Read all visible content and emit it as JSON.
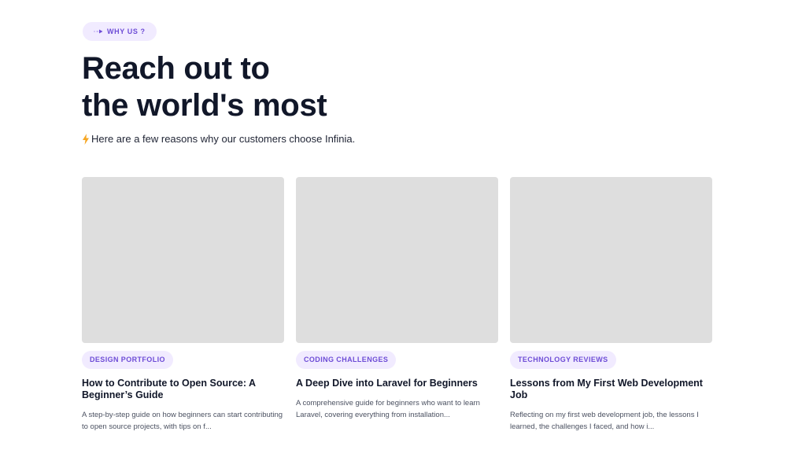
{
  "badge": {
    "label": "WHY US ?",
    "icon": "arrow-right-icon"
  },
  "hero": {
    "title_line1": "Reach out to",
    "title_line2": "the world's most",
    "subtitle": "Here are a few reasons why our customers choose Infinia.",
    "subtitle_icon": "lightning-bolt-icon"
  },
  "colors": {
    "accent": "#6d4cd6",
    "pill_background": "#f1ebff",
    "heading": "#111729",
    "thumbnail_placeholder": "#dedede",
    "bolt": "#f6a623"
  },
  "cards": [
    {
      "tag": "DESIGN PORTFOLIO",
      "title": "How to Contribute to Open Source: A Beginner’s Guide",
      "description": "A step-by-step guide on how beginners can start contributing to open source projects, with tips on f..."
    },
    {
      "tag": "CODING CHALLENGES",
      "title": "A Deep Dive into Laravel for Beginners",
      "description": "A comprehensive guide for beginners who want to learn Laravel, covering everything from installation..."
    },
    {
      "tag": "TECHNOLOGY REVIEWS",
      "title": "Lessons from My First Web Development Job",
      "description": "Reflecting on my first web development job, the lessons I learned, the challenges I faced, and how i..."
    }
  ]
}
